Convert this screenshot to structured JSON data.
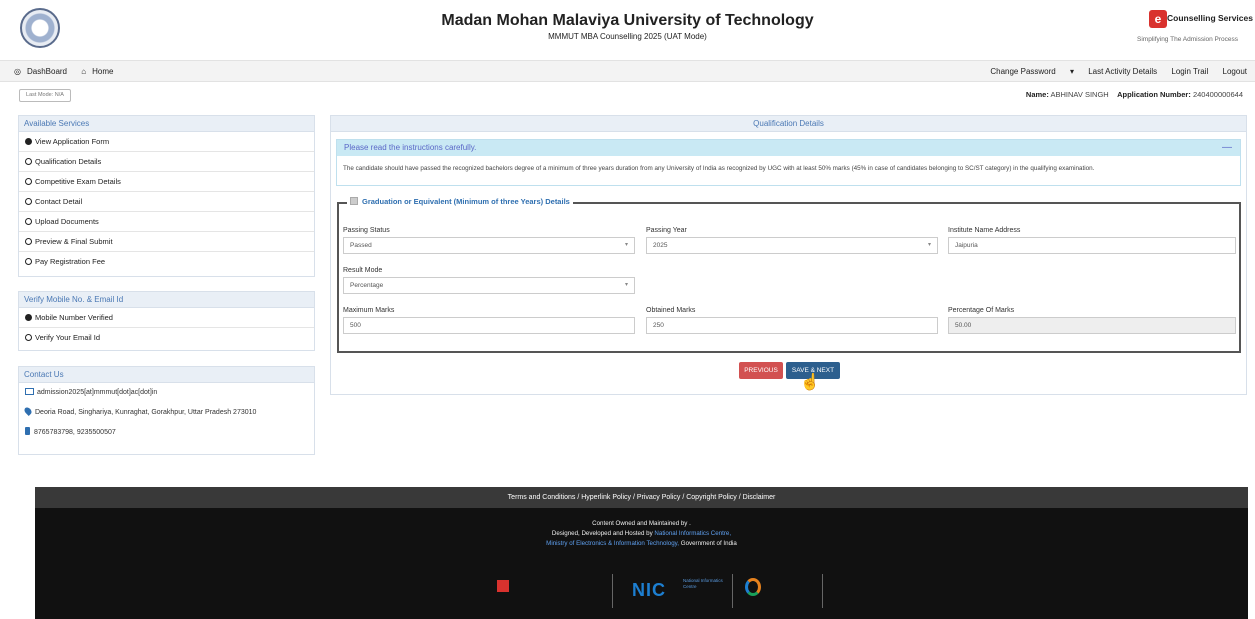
{
  "header": {
    "title": "Madan Mohan Malaviya University of Technology",
    "subtitle": "MMMUT MBA Counselling 2025 (UAT Mode)",
    "brand_name": "Counselling Services",
    "brand_tagline": "Simplifying The Admission Process"
  },
  "nav": {
    "dashboard": "DashBoard",
    "home": "Home",
    "change_password": "Change Password",
    "last_activity": "Last Activity Details",
    "login_trail": "Login Trail",
    "logout": "Logout"
  },
  "last_mode": "Last Mode: N/A",
  "user": {
    "name_label": "Name:",
    "name": "ABHINAV SINGH",
    "app_label": "Application Number:",
    "app_number": "240400000644"
  },
  "services": {
    "title": "Available Services",
    "items": [
      "View Application Form",
      "Qualification Details",
      "Competitive Exam Details",
      "Contact Detail",
      "Upload Documents",
      "Preview & Final Submit",
      "Pay Registration Fee"
    ]
  },
  "verify": {
    "title": "Verify Mobile No. & Email Id",
    "items": [
      "Mobile Number Verified",
      "Verify Your Email Id"
    ]
  },
  "contact": {
    "title": "Contact Us",
    "email": "admission2025[at]mmmut[dot]ac[dot]in",
    "address": "Deoria Road, Singhariya, Kunraghat, Gorakhpur, Uttar Pradesh 273010",
    "phone": "8765783798, 9235500507"
  },
  "main": {
    "title": "Qualification Details",
    "instr_title": "Please read the instructions carefully.",
    "instr_text": "The candidate should have passed the recognized bachelors degree of a minimum of three years duration from any University of India as recognized by UGC with at least 50% marks (45% in case of candidates belonging to SC/ST category) in the qualifying examination.",
    "legend": "Graduation or Equivalent (Minimum of three Years) Details",
    "fields": {
      "passing_status_label": "Passing Status",
      "passing_status": "Passed",
      "passing_year_label": "Passing Year",
      "passing_year": "2025",
      "institute_label": "Institute Name Address",
      "institute": "Jaipuria",
      "result_mode_label": "Result Mode",
      "result_mode": "Percentage",
      "max_marks_label": "Maximum Marks",
      "max_marks": "500",
      "obtained_label": "Obtained Marks",
      "obtained": "250",
      "percentage_label": "Percentage Of Marks",
      "percentage": "50.00"
    },
    "btn_prev": "PREVIOUS",
    "btn_save": "SAVE & NEXT"
  },
  "footer": {
    "links": "Terms and Conditions / Hyperlink Policy / Privacy Policy / Copyright Policy / Disclaimer",
    "owned": "Content Owned and Maintained by .",
    "designed": "Designed, Developed and Hosted by",
    "nic": "National Informatics Centre,",
    "ministry": "Ministry of Electronics & Information Technology,",
    "govt": "Government of India",
    "nic_logo": "NIC",
    "nic_sub": "National Informatics Centre"
  }
}
